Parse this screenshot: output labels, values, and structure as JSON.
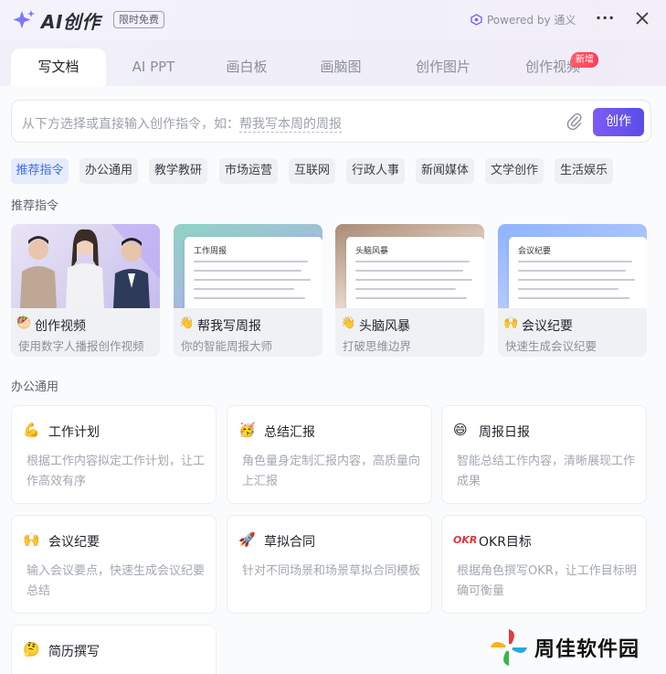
{
  "header": {
    "app_title": "AI创作",
    "badge": "限时免费",
    "powered_by": "Powered by 通义"
  },
  "tabs": [
    {
      "label": "写文档",
      "active": true
    },
    {
      "label": "AI PPT"
    },
    {
      "label": "画白板"
    },
    {
      "label": "画脑图"
    },
    {
      "label": "创作图片"
    },
    {
      "label": "创作视频",
      "tag": "新增"
    }
  ],
  "input": {
    "placeholder_prefix": "从下方选择或直接输入创作指令，如：",
    "placeholder_example": "帮我写本周的周报",
    "submit_label": "创作"
  },
  "chips": [
    "推荐指令",
    "办公通用",
    "教学教研",
    "市场运营",
    "互联网",
    "行政人事",
    "新闻媒体",
    "文学创作",
    "生活娱乐"
  ],
  "recommend": {
    "section_title": "推荐指令",
    "cards": [
      {
        "title": "创作视频",
        "subtitle": "使用数字人播报创作视频",
        "emoji": "🥙"
      },
      {
        "title": "帮我写周报",
        "subtitle": "你的智能周报大师",
        "emoji": "👋",
        "doc_title": "工作周报"
      },
      {
        "title": "头脑风暴",
        "subtitle": "打破思维边界",
        "emoji": "👋",
        "doc_title": "头脑风暴"
      },
      {
        "title": "会议纪要",
        "subtitle": "快速生成会议纪要",
        "emoji": "🙌",
        "doc_title": "会议纪要"
      }
    ]
  },
  "office": {
    "section_title": "办公通用",
    "cards": [
      {
        "title": "工作计划",
        "desc": "根据工作内容拟定工作计划，让工作高效有序",
        "emoji": "💪"
      },
      {
        "title": "总结汇报",
        "desc": "角色量身定制汇报内容，高质量向上汇报",
        "emoji": "🥳"
      },
      {
        "title": "周报日报",
        "desc": "智能总结工作内容，清晰展现工作成果",
        "emoji": "😄"
      },
      {
        "title": "会议纪要",
        "desc": "输入会议要点，快速生成会议纪要总结",
        "emoji": "🙌"
      },
      {
        "title": "草拟合同",
        "desc": "针对不同场景和场景草拟合同模板",
        "emoji": "🚀"
      },
      {
        "title": "OKR目标",
        "desc": "根据角色撰写OKR，让工作目标明确可衡量",
        "emoji": "OKR"
      },
      {
        "title": "简历撰写",
        "desc": "",
        "emoji": "🤔"
      }
    ]
  },
  "watermark": {
    "text": "周佳软件园"
  },
  "colors": {
    "accent": "#5b4de8",
    "chip_active": "#3b6cf6",
    "new_tag": "#ff3b57"
  }
}
